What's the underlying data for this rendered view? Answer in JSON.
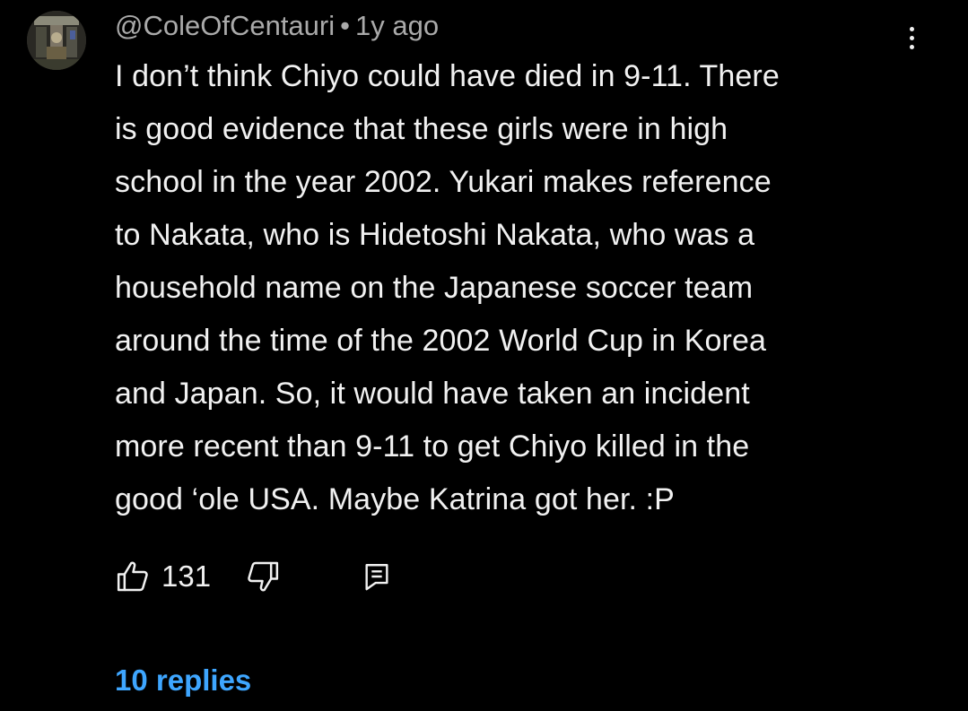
{
  "comment": {
    "author": "@ColeOfCentauri",
    "separator": "•",
    "timestamp": "1y ago",
    "text": "I don’t think Chiyo could have died in 9-11. There is good evidence that these girls were in high school in the year 2002. Yukari makes reference to Nakata, who is Hidetoshi Nakata, who was a household name on the Japanese soccer team around the time of the 2002 World Cup in Korea and Japan. So, it would have taken an incident more recent than 9-11 to get Chiyo killed in the good ‘ole USA. Maybe Katrina got her. :P",
    "text_lines": [
      "I don’t think Chiyo could have died in 9-11. There",
      "is good evidence that these girls were in high",
      "school in the year 2002. Yukari makes reference",
      "to Nakata, who is Hidetoshi Nakata, who was a",
      "household name on the Japanese soccer team",
      "around the time of the 2002 World Cup in Korea",
      "and Japan. So, it would have taken an incident",
      "more recent than 9-11 to get Chiyo killed in the",
      "good ‘ole USA. Maybe Katrina got her. :P"
    ],
    "like_count": "131",
    "replies_label": "10 replies"
  },
  "icons": {
    "avatar": "avatar-image",
    "more": "more-vertical-icon",
    "like": "thumbs-up-icon",
    "dislike": "thumbs-down-icon",
    "reply": "reply-comment-icon"
  },
  "colors": {
    "background": "#000000",
    "text": "#f1f1f1",
    "meta": "#aaaaaa",
    "link": "#3ea6ff"
  }
}
